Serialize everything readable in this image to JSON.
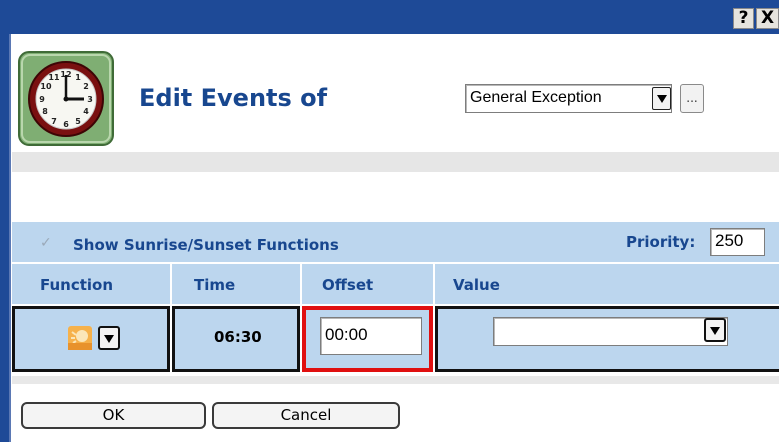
{
  "window": {
    "help_label": "?",
    "close_label": "X",
    "title_bar_color": "#1e4a97"
  },
  "header": {
    "icon": "clock-icon",
    "title": "Edit Events of",
    "schedule_select": {
      "value": "General Exception"
    },
    "browse_label": "..."
  },
  "options": {
    "show_sunrise_label": "Show Sunrise/Sunset Functions",
    "show_sunrise_checked": true,
    "priority_label": "Priority:",
    "priority_value": "250"
  },
  "table": {
    "columns": [
      "Function",
      "Time",
      "Offset",
      "Value"
    ],
    "rows": [
      {
        "function_icon": "sunrise-icon",
        "time": "06:30",
        "offset": "00:00",
        "value": ""
      }
    ]
  },
  "buttons": {
    "ok": "OK",
    "cancel": "Cancel"
  },
  "colors": {
    "heading": "#18478f",
    "panel": "#bcd6ee",
    "highlight": "#e01010"
  }
}
